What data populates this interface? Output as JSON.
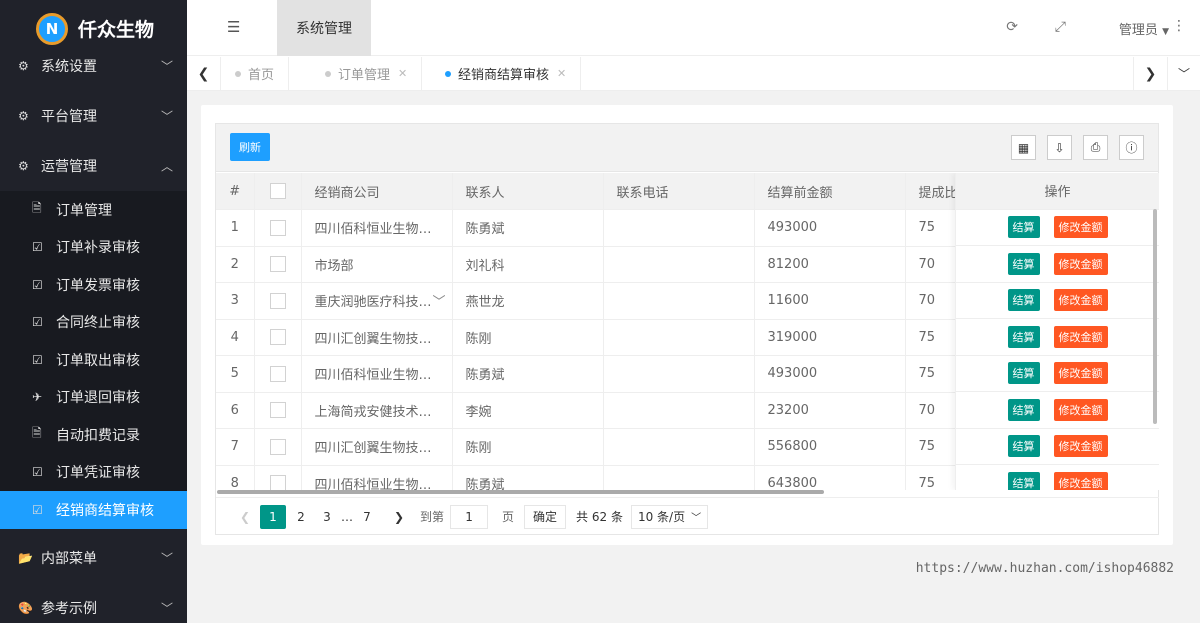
{
  "app": {
    "brand": "仟众生物",
    "logo_letter": "N"
  },
  "sidebar": {
    "groups": [
      {
        "label": "系统设置",
        "icon": "gears-icon",
        "arrow": "﹀"
      },
      {
        "label": "平台管理",
        "icon": "gears-icon",
        "arrow": "﹀"
      },
      {
        "label": "运营管理",
        "icon": "gears-icon",
        "arrow": "︿"
      }
    ],
    "items": [
      {
        "label": "订单管理",
        "icon": "document-icon"
      },
      {
        "label": "订单补录审核",
        "icon": "checkbox-icon"
      },
      {
        "label": "订单发票审核",
        "icon": "checkbox-icon"
      },
      {
        "label": "合同终止审核",
        "icon": "checkbox-icon"
      },
      {
        "label": "订单取出审核",
        "icon": "checkbox-icon"
      },
      {
        "label": "订单退回审核",
        "icon": "plane-icon"
      },
      {
        "label": "自动扣费记录",
        "icon": "document-icon"
      },
      {
        "label": "订单凭证审核",
        "icon": "checkbox-icon"
      },
      {
        "label": "经销商结算审核",
        "icon": "checkbox-icon"
      }
    ],
    "bottom": [
      {
        "label": "内部菜单",
        "icon": "folder-icon"
      },
      {
        "label": "参考示例",
        "icon": "palette-icon"
      }
    ]
  },
  "topbar": {
    "title": "系统管理",
    "user": "管理员"
  },
  "tabs": [
    {
      "label": "首页",
      "closable": false
    },
    {
      "label": "订单管理",
      "closable": true
    },
    {
      "label": "经销商结算审核",
      "closable": true
    }
  ],
  "toolbar": {
    "refresh_label": "刷新"
  },
  "table": {
    "columns": [
      "#",
      "",
      "经销商公司",
      "联系人",
      "联系电话",
      "结算前金额",
      "提成比例",
      "操作"
    ],
    "rows": [
      {
        "no": "1",
        "company": "四川佰科恒业生物…",
        "contact": "陈勇斌",
        "phone": "",
        "amount": "493000",
        "ratio": "75"
      },
      {
        "no": "2",
        "company": "市场部",
        "contact": "刘礼科",
        "phone": "",
        "amount": "81200",
        "ratio": "70"
      },
      {
        "no": "3",
        "company": "重庆润驰医疗科技…",
        "contact": "燕世龙",
        "phone": "",
        "amount": "11600",
        "ratio": "70"
      },
      {
        "no": "4",
        "company": "四川汇创翼生物技…",
        "contact": "陈刚",
        "phone": "",
        "amount": "319000",
        "ratio": "75"
      },
      {
        "no": "5",
        "company": "四川佰科恒业生物…",
        "contact": "陈勇斌",
        "phone": "",
        "amount": "493000",
        "ratio": "75"
      },
      {
        "no": "6",
        "company": "上海简戎安健技术…",
        "contact": "李婉",
        "phone": "",
        "amount": "23200",
        "ratio": "70"
      },
      {
        "no": "7",
        "company": "四川汇创翼生物技…",
        "contact": "陈刚",
        "phone": "",
        "amount": "556800",
        "ratio": "75"
      },
      {
        "no": "8",
        "company": "四川佰科恒业生物…",
        "contact": "陈勇斌",
        "phone": "",
        "amount": "643800",
        "ratio": "75"
      }
    ],
    "op_settle": "结算",
    "op_modify": "修改金额"
  },
  "pager": {
    "pages": [
      "1",
      "2",
      "3",
      "…",
      "7"
    ],
    "goto_label": "到第",
    "goto_value": "1",
    "page_unit": "页",
    "confirm": "确定",
    "total": "共 62 条",
    "page_size": "10 条/页"
  },
  "watermark": "https://www.huzhan.com/ishop46882"
}
